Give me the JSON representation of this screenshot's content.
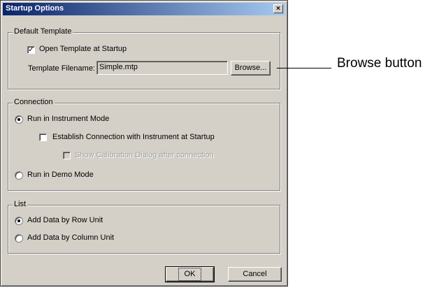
{
  "dialog": {
    "title": "Startup Options",
    "close_glyph": "×"
  },
  "default_template": {
    "legend": "Default Template",
    "open_at_startup": {
      "label": "Open Template at Startup",
      "checked": true
    },
    "filename_label": "Template Filename:",
    "filename_value": "Simple.mtp",
    "browse_label": "Browse..."
  },
  "connection": {
    "legend": "Connection",
    "instrument_mode": {
      "label": "Run in Instrument Mode",
      "selected": true
    },
    "establish_connection": {
      "label": "Establish Connection with Instrument at Startup",
      "checked": false
    },
    "show_calibration": {
      "label": "Show Calibration Dialog after connection",
      "checked": false,
      "enabled": false
    },
    "demo_mode": {
      "label": "Run in Demo Mode",
      "selected": false
    }
  },
  "list": {
    "legend": "List",
    "by_row": {
      "label": "Add Data by Row Unit",
      "selected": true
    },
    "by_column": {
      "label": "Add Data by Column Unit",
      "selected": false
    }
  },
  "buttons": {
    "ok_label": "OK",
    "cancel_label": "Cancel"
  },
  "callout": {
    "text": "Browse button"
  },
  "colors": {
    "face": "#d4d0c8",
    "title_start": "#0a246a",
    "title_end": "#a6caf0",
    "disabled_text": "#a0a0a0"
  }
}
